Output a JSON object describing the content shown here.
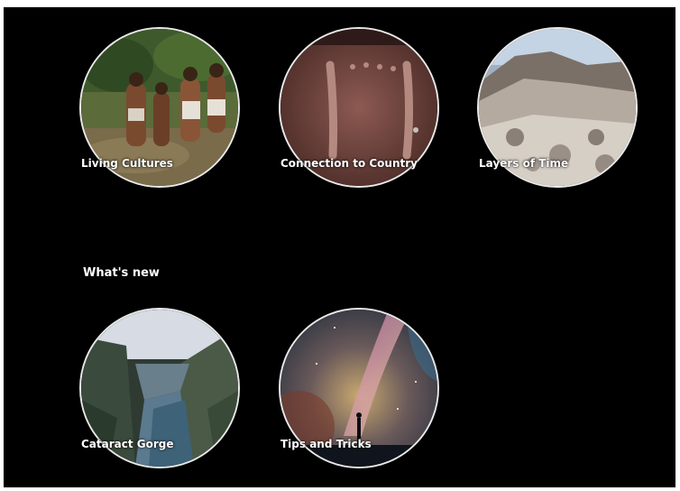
{
  "featured": {
    "items": [
      {
        "label": "Living Cultures"
      },
      {
        "label": "Connection to Country"
      },
      {
        "label": "Layers of Time"
      }
    ]
  },
  "whats_new": {
    "title": "What's new",
    "items": [
      {
        "label": "Cataract Gorge"
      },
      {
        "label": "Tips and Tricks"
      }
    ]
  },
  "colors": {
    "background": "#000000",
    "ring": "#e9e9e9",
    "label": "#ffffff"
  }
}
